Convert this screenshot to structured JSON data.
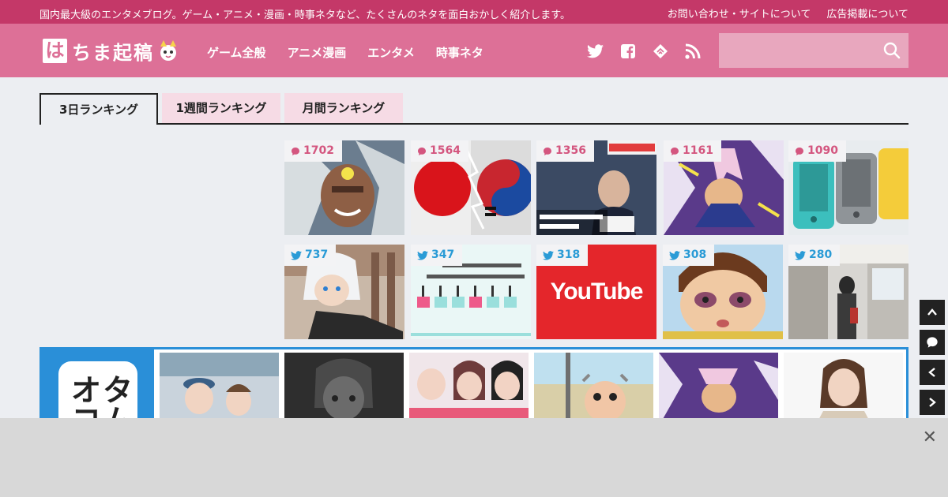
{
  "topbar": {
    "tagline": "国内最大級のエンタメブログ。ゲーム・アニメ・漫画・時事ネタなど、たくさんのネタを面白おかしく紹介します。",
    "links": [
      "お問い合わせ・サイトについて",
      "広告掲載について"
    ]
  },
  "header": {
    "logo_box": "は",
    "logo_text": "ちま起稿",
    "nav": [
      "ゲーム全般",
      "アニメ漫画",
      "エンタメ",
      "時事ネタ"
    ],
    "social_icons": [
      "twitter-icon",
      "facebook-icon",
      "feedly-icon",
      "rss-icon"
    ],
    "search_placeholder": ""
  },
  "tabs": [
    {
      "label": "3日ランキング",
      "active": true
    },
    {
      "label": "1週間ランキング",
      "active": false
    },
    {
      "label": "月間ランキング",
      "active": false
    }
  ],
  "ranking": {
    "comment_row": [
      "1702",
      "1564",
      "1356",
      "1161",
      "1090"
    ],
    "tweet_row": [
      "737",
      "347",
      "318",
      "308",
      "280"
    ]
  },
  "youtube_text": "YouTube",
  "otacom": {
    "logo_text": "オタコム"
  },
  "colors": {
    "topbar": "#c43868",
    "header": "#dd7097",
    "comment_badge": "#d4567f",
    "tweet_badge": "#2a9bd6",
    "otacom_blue": "#2a8fd8"
  }
}
